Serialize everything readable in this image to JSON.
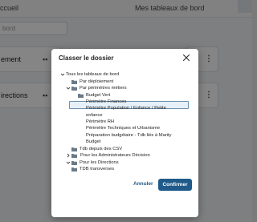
{
  "background": {
    "tabs": {
      "home": "ccueil",
      "my_boards": "Mes tableaux de bord"
    },
    "search": {
      "placeholder": "bord"
    },
    "cards": [
      {
        "label": "ement"
      },
      {
        "label": "irections"
      }
    ]
  },
  "modal": {
    "title": "Classer le dossier",
    "tree": [
      {
        "label": "Tous les tableaux de bord",
        "kind": "root"
      },
      {
        "label": "Par déploiement"
      },
      {
        "label": "Par périmètres métiers"
      },
      {
        "label": "Budget Vert"
      },
      {
        "label": "Périmètre Finances"
      },
      {
        "label": "Périmètre Population / Enfance / Petite"
      },
      {
        "label": "enfance"
      },
      {
        "label": "Périmètre RH"
      },
      {
        "label": "Périmètre Techniques et Urbanisme"
      },
      {
        "label": "Préparation budgétaire - Tdb liés à Marity"
      },
      {
        "label": "Budget"
      },
      {
        "label": "Tdb depuis des CSV"
      },
      {
        "label": "Pour les Administrateurs Décision",
        "selected": true
      },
      {
        "label": "Pour les Directions"
      },
      {
        "label": "TDB transverses"
      }
    ],
    "cancel_label": "Annuler",
    "confirm_label": "Confirmer"
  },
  "colors": {
    "accent": "#1f5a8a",
    "folder": "#6b7a86",
    "selection_fill": "#e6f0f8",
    "selection_border": "#6a8fb0"
  }
}
